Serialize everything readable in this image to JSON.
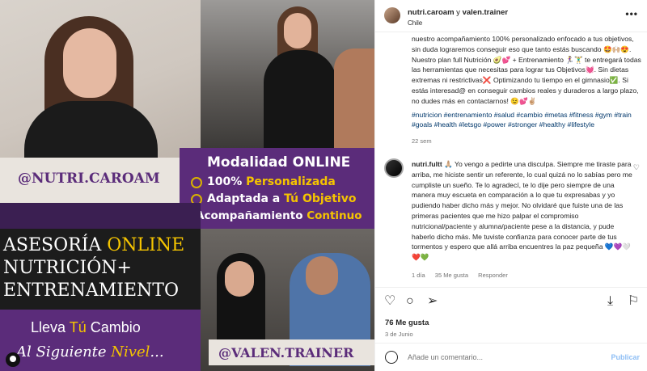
{
  "media": {
    "badge_title": "Modalidad ONLINE",
    "badge_items": [
      {
        "pre": "100% ",
        "hl": "Personalizada",
        "post": ""
      },
      {
        "pre": "Adaptada a ",
        "hl": "Tú Objetivo",
        "post": ""
      },
      {
        "pre": "Acompañamiento ",
        "hl": "Continuo",
        "post": ""
      }
    ],
    "handle_1": "@NUTRI.CAROAM",
    "handle_2": "@VALEN.TRAINER",
    "ases_line1_pre": "ASESORÍA ",
    "ases_line1_hl": "ONLINE",
    "ases_line2": "NUTRICIÓN+",
    "ases_line3": "ENTRENAMIENTO",
    "cta_a_pre": "Lleva ",
    "cta_a_hl": "Tú",
    "cta_a_post": " Cambio",
    "cta_b_pre": "Al Siguiente ",
    "cta_b_hl": "Nivel",
    "cta_b_post": "..."
  },
  "header": {
    "user1": "nutri.caroam",
    "connector": " y ",
    "user2": "valen.trainer",
    "location": "Chile",
    "more": "•••"
  },
  "caption": {
    "text": "nuestro acompañamiento 100% personalizado enfocado a tus objetivos, sin duda lograremos conseguir eso que tanto estás buscando 🤩🙌🏼😍. Nuestro plan full Nutrición 🥑💕 + Entrenamiento 🏃‍♀️🏋️‍♂️ te entregará todas las herramientas que necesitas para lograr tus Objetivos💓. Sin dietas extremas ni restrictivas❌ Optimizando tu tiempo en el gimnasio✅. Si estás interesad@ en conseguir cambios reales y duraderos a largo plazo, no dudes más en contactarnos! 😉💕✌🏼",
    "tags": "#nutricion #entrenamiento #salud #cambio #metas #fitness #gym #train #goals #health #letsgo #power #stronger #healthy #lifestyle",
    "time": "22 sem"
  },
  "comment": {
    "user": "nutri.fultt",
    "text": "🙏🏼 Yo vengo a pedirte una disculpa. Siempre me tiraste para arriba, me hiciste sentir un referente, lo cual quizá no lo sabías pero me cumpliste un sueño. Te lo agradecí, te lo dije pero siempre de una manera muy escueta en comparación a lo que tu expresabas y yo pudiendo haber dicho más y mejor. No olvidaré que fuiste una de las primeras pacientes que me hizo palpar el compromiso nutricional/paciente y alumna/paciente pese a la distancia, y pude haberlo dicho más. Me tuviste confianza para conocer parte de tus tormentos y espero que allá arriba encuentres la paz pequeña 💙💜🤍❤️💚",
    "time": "1 día",
    "likes": "35 Me gusta",
    "reply": "Responder",
    "heart_icon": "heart-outline-icon"
  },
  "actions": {
    "likes": "76 Me gusta",
    "date": "3 de Junio",
    "icons": [
      "heart-icon",
      "comment-icon",
      "share-icon",
      "download-icon",
      "bookmark-icon"
    ]
  },
  "add_comment": {
    "placeholder": "Añade un comentario...",
    "publish": "Publicar"
  },
  "colors": {
    "brand_purple": "#5b2c7a",
    "accent_yellow": "#f5c400",
    "link_blue": "#00376b",
    "publish_blue": "#8fbff5"
  }
}
